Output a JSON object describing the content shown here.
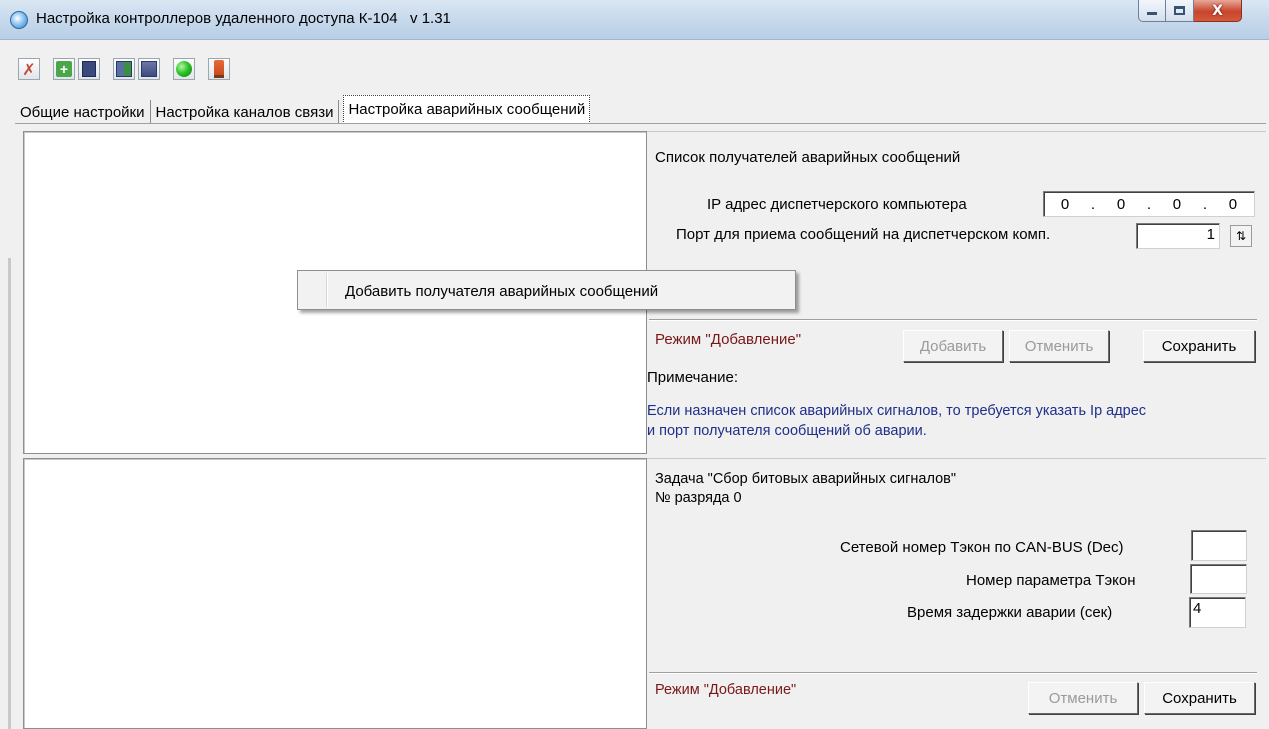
{
  "window": {
    "title": "Настройка контроллеров удаленного доступа К-104   v 1.31",
    "controls": {
      "minimize_icon": "minimize-icon",
      "maximize_icon": "maximize-icon",
      "close_glyph": "X"
    }
  },
  "toolbar": {
    "buttons": [
      {
        "icon": "delete-document-icon"
      },
      {
        "icon": "add-icon"
      },
      {
        "icon": "document-icon"
      },
      {
        "icon": "tree-import-icon"
      },
      {
        "icon": "tree-export-icon"
      },
      {
        "icon": "green-circle-icon"
      },
      {
        "icon": "stamp-icon"
      }
    ]
  },
  "tabs": [
    {
      "label": "Общие настройки"
    },
    {
      "label": "Настройка каналов связи"
    },
    {
      "label": "Настройка аварийных сообщений",
      "active": true
    }
  ],
  "recipients": {
    "heading": "Список получателей аварийных сообщений",
    "ip_label": "IP адрес диспетчерского компьютера",
    "ip_octets": [
      "0",
      ".",
      "0",
      ".",
      "0",
      ".",
      "0"
    ],
    "port_label": "Порт для приема сообщений  на диспетчерском комп.",
    "port_value": "1",
    "mode": "Режим \"Добавление\"",
    "btn_add": "Добавить",
    "btn_cancel": "Отменить",
    "btn_save": "Сохранить",
    "note_label": "Примечание:",
    "note_line1": "Если назначен список аварийных сигналов, то требуется указать Ip адрес",
    "note_line2": "и порт получателя сообщений об аварии."
  },
  "task": {
    "title": "Задача \"Сбор битовых аварийных сигналов\"",
    "bit_label": "№ разряда 0",
    "net_label": "Сетевой номер Тэкон по CAN-BUS  (Dec)",
    "net_value": "",
    "param_label": "Номер параметра Тэкон",
    "param_value": "",
    "delay_label": "Время задержки аварии (сек)",
    "delay_value": "4",
    "mode": "Режим \"Добавление\"",
    "btn_cancel": "Отменить",
    "btn_save": "Сохранить"
  },
  "context_menu": {
    "item": "Добавить получателя аварийных сообщений"
  }
}
